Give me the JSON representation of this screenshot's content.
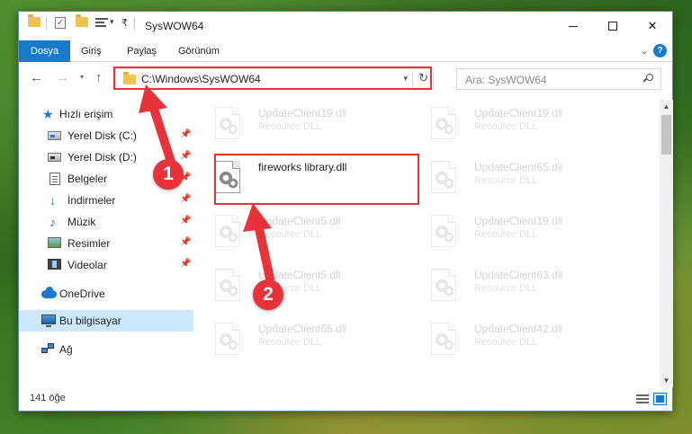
{
  "window": {
    "title": "SysWOW64",
    "controls": {
      "minimize": "—",
      "maximize": "□",
      "close": "✕"
    }
  },
  "ribbon": {
    "tabs": [
      {
        "label": "Dosya",
        "active": true
      },
      {
        "label": "Giriş",
        "active": false
      },
      {
        "label": "Paylaş",
        "active": false
      },
      {
        "label": "Görünüm",
        "active": false
      }
    ],
    "help": "?"
  },
  "navigation": {
    "back": "←",
    "forward": "→",
    "recent": "⌄",
    "up": "↑",
    "address": "C:\\Windows\\SysWOW64",
    "search_placeholder": "Ara: SysWOW64"
  },
  "sidebar": {
    "items": [
      {
        "label": "Hızlı erişim",
        "icon": "star-icon",
        "pinned": false
      },
      {
        "label": "Yerel Disk (C:)",
        "icon": "drive-icon",
        "pinned": true
      },
      {
        "label": "Yerel Disk (D:)",
        "icon": "drive-icon",
        "pinned": true
      },
      {
        "label": "Belgeler",
        "icon": "documents-icon",
        "pinned": true
      },
      {
        "label": "İndirmeler",
        "icon": "download-icon",
        "pinned": true
      },
      {
        "label": "Müzik",
        "icon": "music-icon",
        "pinned": true
      },
      {
        "label": "Resimler",
        "icon": "pictures-icon",
        "pinned": true
      },
      {
        "label": "Videolar",
        "icon": "videos-icon",
        "pinned": true
      },
      {
        "label": "OneDrive",
        "icon": "onedrive-icon",
        "pinned": false
      },
      {
        "label": "Bu bilgisayar",
        "icon": "computer-icon",
        "pinned": false,
        "selected": true
      },
      {
        "label": "Ağ",
        "icon": "network-icon",
        "pinned": false
      }
    ]
  },
  "files": {
    "highlighted": {
      "name": "fireworks library.dll"
    },
    "left_column": [
      {
        "name": "UpdateClient19.dll",
        "type": "Resource DLL"
      },
      {
        "name": "fireworks library.dll",
        "type": ""
      },
      {
        "name": "UpdateClient5.dll",
        "type": "Resource DLL"
      },
      {
        "name": "UpdateClient5.dll",
        "type": "Resource DLL"
      },
      {
        "name": "UpdateClient65.dll",
        "type": "Resource DLL"
      }
    ],
    "right_column": [
      {
        "name": "UpdateClient19.dll",
        "type": "Resource DLL"
      },
      {
        "name": "UpdateClient65.dll",
        "type": "Resource DLL"
      },
      {
        "name": "UpdateClient19.dll",
        "type": "Resource DLL"
      },
      {
        "name": "UpdateClient63.dll",
        "type": "Resource DLL"
      },
      {
        "name": "UpdateClient42.dll",
        "type": "Resource DLL"
      }
    ]
  },
  "status": {
    "item_count": "141 öğe"
  },
  "annotations": {
    "step1": "1",
    "step2": "2"
  },
  "colors": {
    "accent": "#1979ca",
    "annotation": "#e8333a",
    "selection": "#cce8ff"
  }
}
